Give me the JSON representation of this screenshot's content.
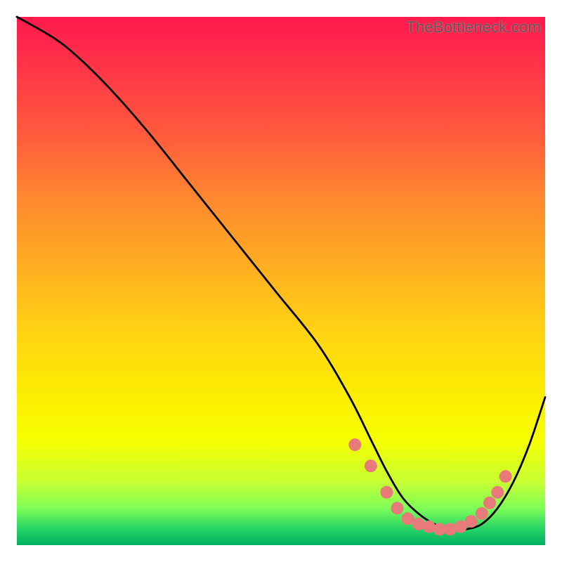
{
  "watermark": "TheBottleneck.com",
  "chart_data": {
    "type": "line",
    "title": "",
    "xlabel": "",
    "ylabel": "",
    "xlim": [
      0,
      100
    ],
    "ylim": [
      0,
      100
    ],
    "grid": false,
    "legend": false,
    "background": "heatmap-gradient",
    "series": [
      {
        "name": "bottleneck-curve",
        "x": [
          0,
          7,
          12,
          18,
          25,
          33,
          41,
          49,
          57,
          63,
          67,
          70,
          73,
          76,
          79,
          82,
          85,
          88,
          91,
          94,
          97,
          100
        ],
        "y": [
          100,
          96,
          92,
          86,
          78,
          68,
          58,
          48,
          38,
          28,
          20,
          14,
          9,
          6,
          4,
          3,
          3,
          4,
          7,
          12,
          19,
          28
        ]
      }
    ],
    "markers": {
      "name": "highlight-dots",
      "color": "#e87a7a",
      "radius": 9,
      "points_xy": [
        [
          64,
          19
        ],
        [
          67,
          15
        ],
        [
          70,
          10
        ],
        [
          72,
          7
        ],
        [
          74,
          5
        ],
        [
          76,
          4
        ],
        [
          78,
          3.5
        ],
        [
          80,
          3
        ],
        [
          82,
          3
        ],
        [
          84,
          3.5
        ],
        [
          86,
          4.5
        ],
        [
          88,
          6
        ],
        [
          89.5,
          8
        ],
        [
          91,
          10
        ],
        [
          92.5,
          13
        ]
      ]
    }
  }
}
